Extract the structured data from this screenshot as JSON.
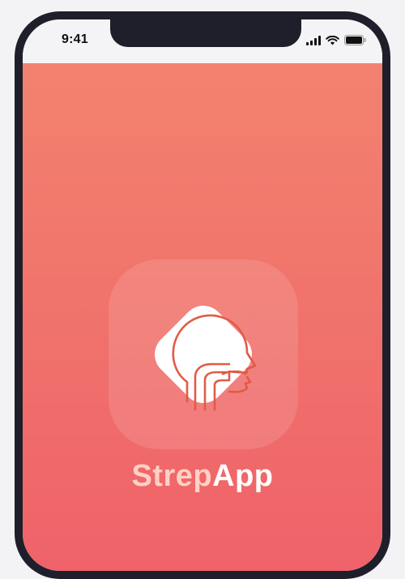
{
  "status_bar": {
    "time": "9:41",
    "icons": [
      "cellular-signal-icon",
      "wifi-icon",
      "battery-icon"
    ]
  },
  "splash": {
    "logo_icon": "head-profile-throat-icon",
    "app_name_part1": "Strep",
    "app_name_part2": "App"
  },
  "colors": {
    "gradient_top": "#f2826f",
    "gradient_bottom": "#ef626a",
    "logo_stroke": "#e35a45",
    "app_name_accent": "#ffd0c5"
  }
}
